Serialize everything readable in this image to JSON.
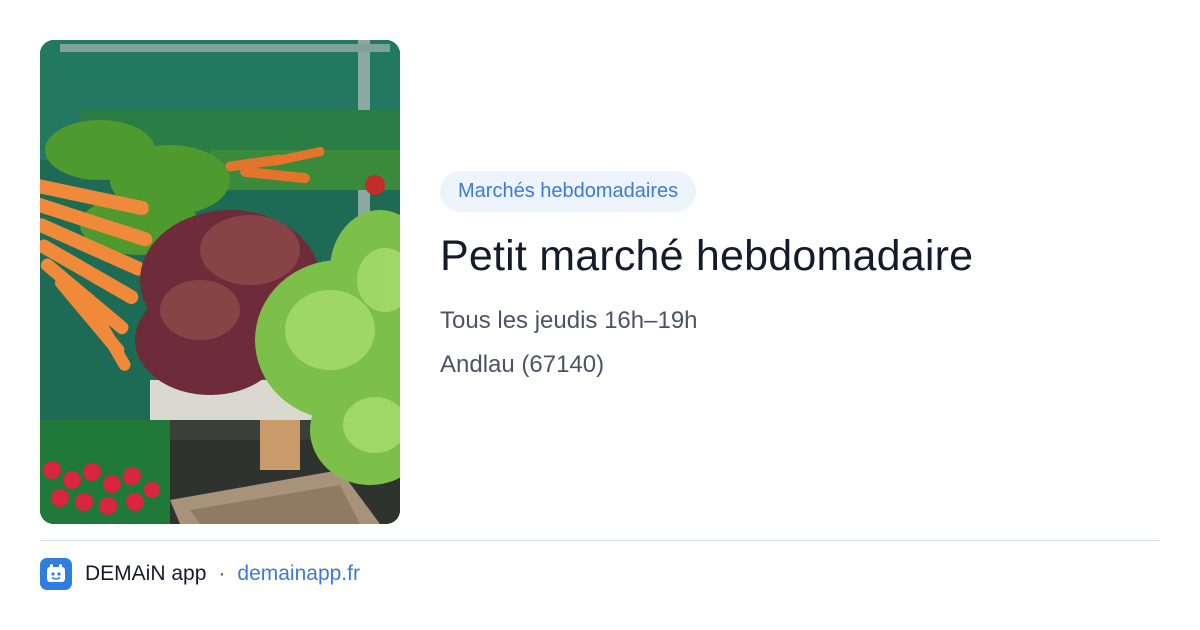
{
  "event": {
    "category": "Marchés hebdomadaires",
    "title": "Petit marché hebdomadaire",
    "schedule": "Tous les jeudis 16h–19h",
    "location": "Andlau (67140)"
  },
  "hero_image": {
    "subject": "vegetable-market-stall",
    "description_icon": "photo-icon"
  },
  "footer": {
    "app_name": "DEMAiN app",
    "separator": "·",
    "domain": "demainapp.fr",
    "logo_icon": "demain-logo-icon"
  },
  "colors": {
    "accent": "#3d7ad6",
    "chip_bg": "#eef4fd",
    "title": "#141b2c",
    "muted": "#4b5465",
    "divider": "#dbe3ea",
    "logo_bg": "#2f7de1"
  }
}
